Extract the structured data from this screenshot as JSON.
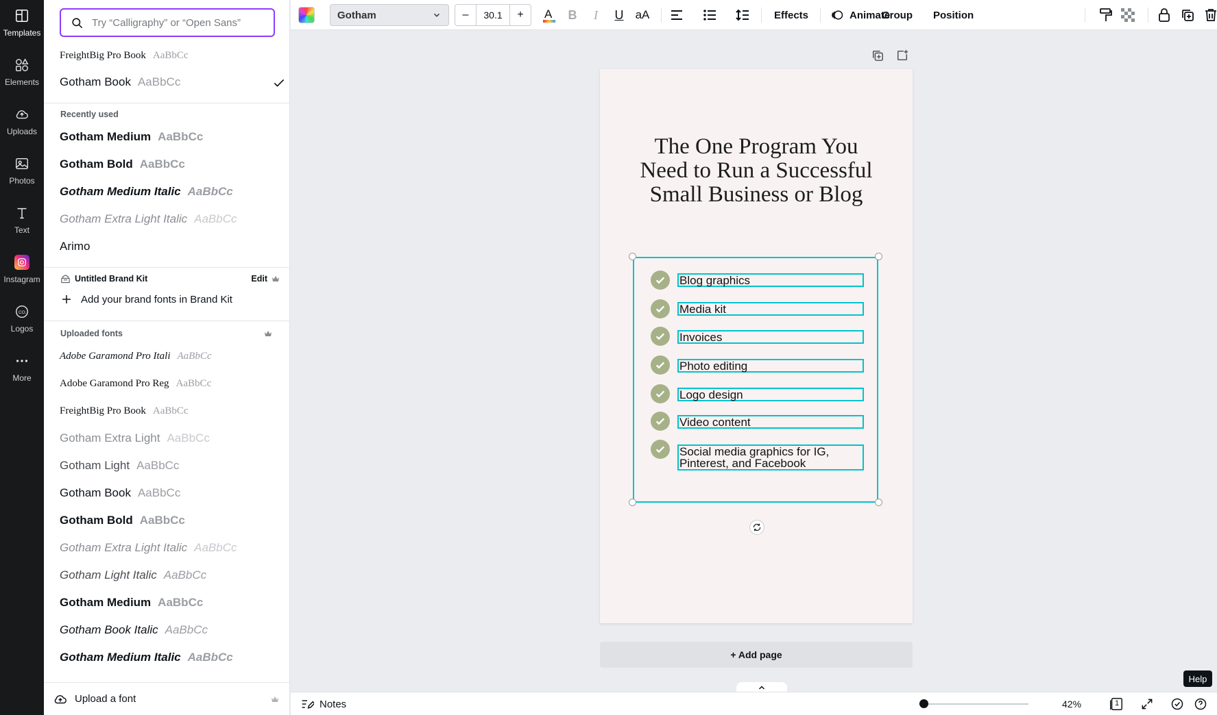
{
  "rail": {
    "items": [
      {
        "label": "Templates",
        "icon": "templates-icon"
      },
      {
        "label": "Elements",
        "icon": "elements-icon"
      },
      {
        "label": "Uploads",
        "icon": "uploads-icon"
      },
      {
        "label": "Photos",
        "icon": "photos-icon"
      },
      {
        "label": "Text",
        "icon": "text-icon"
      },
      {
        "label": "Instagram",
        "icon": "instagram-icon"
      },
      {
        "label": "Logos",
        "icon": "logos-icon"
      },
      {
        "label": "More",
        "icon": "more-icon"
      }
    ]
  },
  "panel": {
    "search_placeholder": "Try “Calligraphy” or “Open Sans”",
    "top_fonts": [
      {
        "name": "FreightBig Pro Book",
        "sample": "AaBbCc"
      },
      {
        "name": "Gotham Book",
        "sample": "AaBbCc",
        "selected": true
      }
    ],
    "recently_used_title": "Recently used",
    "recently_used": [
      {
        "name": "Gotham Medium",
        "sample": "AaBbCc"
      },
      {
        "name": "Gotham Bold",
        "sample": "AaBbCc"
      },
      {
        "name": "Gotham Medium Italic",
        "sample": "AaBbCc"
      },
      {
        "name": "Gotham Extra Light Italic",
        "sample": "AaBbCc"
      },
      {
        "name": "Arimo",
        "sample": ""
      }
    ],
    "brand_kit_title": "Untitled Brand Kit",
    "brand_kit_edit": "Edit",
    "add_brand_fonts": "Add your brand fonts in Brand Kit",
    "uploaded_title": "Uploaded fonts",
    "uploaded": [
      {
        "name": "Adobe Garamond Pro Itali",
        "sample": "AaBbCc"
      },
      {
        "name": "Adobe Garamond Pro Reg",
        "sample": "AaBbCc"
      },
      {
        "name": "FreightBig Pro Book",
        "sample": "AaBbCc"
      },
      {
        "name": "Gotham Extra Light",
        "sample": "AaBbCc"
      },
      {
        "name": "Gotham Light",
        "sample": "AaBbCc"
      },
      {
        "name": "Gotham Book",
        "sample": "AaBbCc"
      },
      {
        "name": "Gotham Bold",
        "sample": "AaBbCc"
      },
      {
        "name": "Gotham Extra Light Italic",
        "sample": "AaBbCc"
      },
      {
        "name": "Gotham Light Italic",
        "sample": "AaBbCc"
      },
      {
        "name": "Gotham Medium",
        "sample": "AaBbCc"
      },
      {
        "name": "Gotham Book Italic",
        "sample": "AaBbCc"
      },
      {
        "name": "Gotham Medium Italic",
        "sample": "AaBbCc"
      }
    ],
    "upload_font": "Upload a font"
  },
  "toolbar": {
    "font_family": "Gotham",
    "font_size": "30.1",
    "minus": "–",
    "plus": "+",
    "effects": "Effects",
    "animate": "Animate",
    "group": "Group",
    "position": "Position"
  },
  "canvas": {
    "headline": "The One Program You\nNeed to Run a Successful\nSmall Business or Blog",
    "items": [
      "Blog graphics",
      "Media kit",
      "Invoices",
      "Photo editing",
      "Logo design",
      "Video content",
      "Social media graphics for IG, Pinterest, and Facebook"
    ],
    "add_page": "+ Add page",
    "check_color": "#a6b188",
    "selection_color": "#00c4cc"
  },
  "bottom": {
    "notes": "Notes",
    "zoom": "42%",
    "zoom_value": 42,
    "page_count": "1",
    "help_tooltip": "Help"
  },
  "colors": {
    "accent": "#8b3dff",
    "rail_bg": "#18191b",
    "page_bg": "#f9f2f2"
  }
}
